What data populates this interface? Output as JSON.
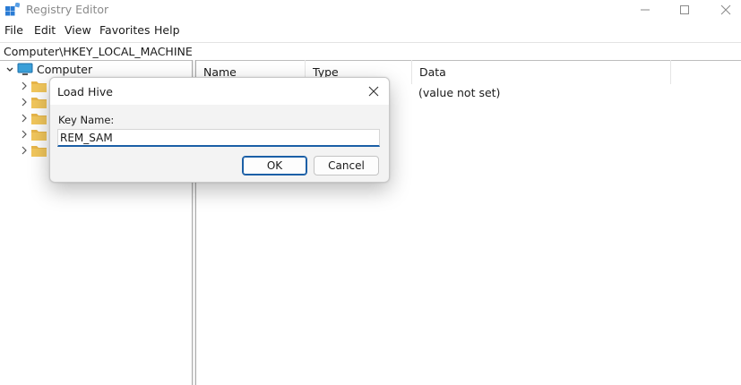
{
  "window": {
    "title": "Registry Editor"
  },
  "menu": [
    "File",
    "Edit",
    "View",
    "Favorites",
    "Help"
  ],
  "address": "Computer\\HKEY_LOCAL_MACHINE",
  "tree": {
    "root_label": "Computer",
    "child_count_visible": 5
  },
  "list": {
    "columns": [
      "Name",
      "Type",
      "Data"
    ],
    "rows": [
      {
        "data": "(value not set)"
      }
    ]
  },
  "dialog": {
    "title": "Load Hive",
    "field_label": "Key Name:",
    "field_value": "REM_SAM",
    "ok_label": "OK",
    "cancel_label": "Cancel"
  },
  "colors": {
    "accent": "#1b5fa6",
    "folder": "#e8b64a"
  }
}
